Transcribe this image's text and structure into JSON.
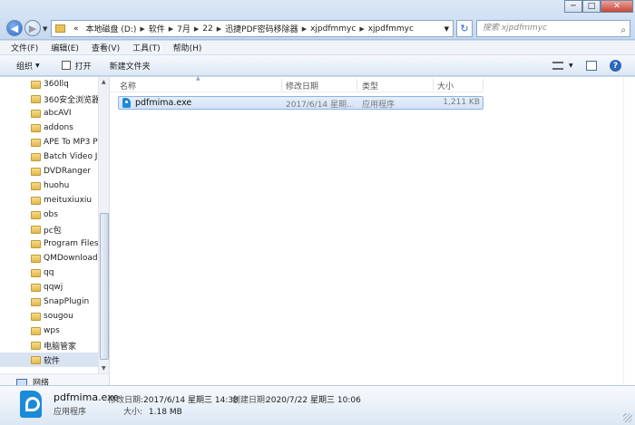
{
  "window": {
    "minimize": "─",
    "maximize": "□",
    "close": "✕"
  },
  "address_bar": {
    "overflow": "«",
    "crumbs": [
      "本地磁盘 (D:)",
      "软件",
      "7月",
      "22",
      "迅捷PDF密码移除器",
      "xjpdfmmyc",
      "xjpdfmmyc"
    ],
    "search_placeholder": "搜索 xjpdfmmyc"
  },
  "menu": [
    "文件(F)",
    "编辑(E)",
    "查看(V)",
    "工具(T)",
    "帮助(H)"
  ],
  "toolbar": {
    "organize": "组织",
    "open": "打开",
    "new_folder": "新建文件夹"
  },
  "nav": {
    "items": [
      "360llq",
      "360安全浏览器",
      "abcAVI",
      "addons",
      "APE To MP3 Pl",
      "Batch Video Jc",
      "DVDRanger",
      "huohu",
      "meituxiuxiu",
      "obs",
      "pc包",
      "Program Files",
      "QMDownload",
      "qq",
      "qqwj",
      "SnapPlugin",
      "sougou",
      "wps",
      "电脑管家",
      "软件"
    ],
    "selected_index": 19,
    "network": "网络"
  },
  "columns": {
    "name": "名称",
    "modified": "修改日期",
    "type": "类型",
    "size": "大小"
  },
  "files": [
    {
      "name": "pdfmima.exe",
      "modified": "2017/6/14 星期...",
      "type": "应用程序",
      "size": "1,211 KB"
    }
  ],
  "details": {
    "name": "pdfmima.exe",
    "modified_label": "修改日期:",
    "modified": "2017/6/14 星期三 14:38",
    "created_label": "创建日期:",
    "created": "2020/7/22 星期三 10:06",
    "type": "应用程序",
    "size_label": "大小:",
    "size": "1.18 MB"
  }
}
